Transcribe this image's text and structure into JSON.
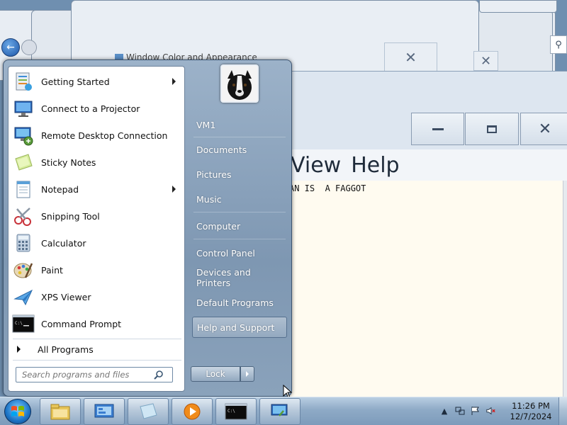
{
  "background_window": {
    "title": "Window Color and Appearance"
  },
  "notepad": {
    "menu": [
      "View",
      "Help"
    ],
    "text": "AN IS  A FAGGOT"
  },
  "start_menu": {
    "programs": [
      {
        "label": "Getting Started",
        "icon": "getting-started-icon",
        "has_submenu": true
      },
      {
        "label": "Connect to a Projector",
        "icon": "projector-icon",
        "has_submenu": false
      },
      {
        "label": "Remote Desktop Connection",
        "icon": "remote-desktop-icon",
        "has_submenu": false
      },
      {
        "label": "Sticky Notes",
        "icon": "sticky-notes-icon",
        "has_submenu": false
      },
      {
        "label": "Notepad",
        "icon": "notepad-icon",
        "has_submenu": true
      },
      {
        "label": "Snipping Tool",
        "icon": "scissors-icon",
        "has_submenu": false
      },
      {
        "label": "Calculator",
        "icon": "calculator-icon",
        "has_submenu": false
      },
      {
        "label": "Paint",
        "icon": "paint-palette-icon",
        "has_submenu": false
      },
      {
        "label": "XPS Viewer",
        "icon": "xps-viewer-icon",
        "has_submenu": false
      },
      {
        "label": "Command Prompt",
        "icon": "command-prompt-icon",
        "has_submenu": false
      }
    ],
    "all_programs": "All Programs",
    "search_placeholder": "Search programs and files",
    "right_items": [
      {
        "label": "VM1"
      },
      {
        "label": "Documents"
      },
      {
        "label": "Pictures"
      },
      {
        "label": "Music"
      },
      {
        "label": "Computer"
      },
      {
        "label": "Control Panel"
      },
      {
        "label": "Devices and Printers"
      },
      {
        "label": "Default Programs"
      },
      {
        "label": "Help and Support",
        "highlighted": true
      }
    ],
    "lock_label": "Lock"
  },
  "taskbar": {
    "pinned": [
      "windows-explorer-icon",
      "control-panel-icon",
      "sticky-notes-icon",
      "media-player-icon",
      "command-prompt-icon",
      "remote-desktop-icon"
    ],
    "clock_time": "11:26 PM",
    "clock_date": "12/7/2024"
  },
  "colors": {
    "start_menu_right": "#8aa2bb",
    "notepad_bg": "#fffbf0",
    "taskbar": "#8eaac6"
  }
}
